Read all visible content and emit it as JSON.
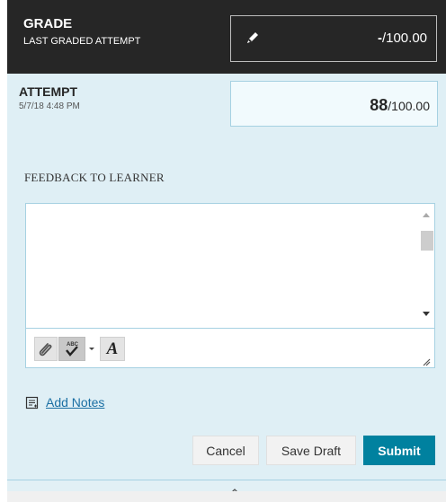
{
  "grade": {
    "title": "GRADE",
    "subtitle": "LAST GRADED ATTEMPT",
    "value_dash": "-",
    "value_max": "/100.00",
    "edit_icon": "pencil-icon"
  },
  "attempt": {
    "title": "ATTEMPT",
    "date": "5/7/18 4:48 PM",
    "score": "88",
    "max": "/100.00"
  },
  "feedback": {
    "label": "FEEDBACK TO LEARNER",
    "value": "",
    "toolbar": {
      "attach_icon": "paperclip-icon",
      "spellcheck_icon": "spellcheck-icon",
      "format_label": "A"
    }
  },
  "notes": {
    "link_label": "Add Notes",
    "icon": "notes-icon"
  },
  "actions": {
    "cancel_label": "Cancel",
    "save_draft_label": "Save Draft",
    "submit_label": "Submit"
  },
  "colors": {
    "header_bg": "#262626",
    "panel_bg": "#dfeff5",
    "accent": "#00819f",
    "link": "#1a6fa3"
  }
}
